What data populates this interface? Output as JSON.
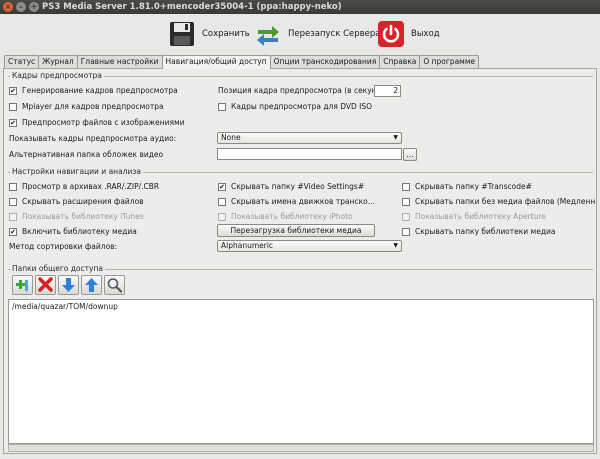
{
  "window": {
    "title": "PS3 Media Server 1.81.0+mencoder35004-1 (ppa:happy-neko)",
    "close_glyph": "×",
    "min_glyph": "–",
    "max_glyph": "+"
  },
  "toolbar": {
    "save_label": "Сохранить",
    "restart_label": "Перезапуск Сервера",
    "quit_label": "Выход"
  },
  "tabs": [
    {
      "label": "Статус"
    },
    {
      "label": "Журнал"
    },
    {
      "label": "Главные настройки"
    },
    {
      "label": "Навигация/общий доступ",
      "active": true
    },
    {
      "label": "Опции транскодирования"
    },
    {
      "label": "Справка"
    },
    {
      "label": "О программе"
    }
  ],
  "thumbnails": {
    "title": "Кадры предпросмотра",
    "gen_thumbs": {
      "label": "Генерирование кадров предпросмотра",
      "checked": true
    },
    "mplayer_thumbs": {
      "label": "Mplayer для кадров предпросмотра",
      "checked": false
    },
    "image_thumbs": {
      "label": "Предпросмотр файлов с изображениями",
      "checked": true
    },
    "thumb_position_label": "Позиция кадра предпросмотра (в секундах):",
    "thumb_position_value": "2",
    "dvd_iso_thumbs": {
      "label": "Кадры предпросмотра для DVD ISO",
      "checked": false
    },
    "audio_thumbs_label": "Показывать кадры предпросмотра аудио:",
    "audio_thumbs_value": "None",
    "alt_cover_label": "Альтернативная папка обложек видео",
    "alt_cover_value": "",
    "browse_label": "..."
  },
  "navigation": {
    "title": "Настройки навигации и анализа",
    "archives": {
      "label": "Просмотр в архивах .RAR/.ZIP/.CBR",
      "checked": false
    },
    "hide_video_settings": {
      "label": "Скрывать папку #Video Settings#",
      "checked": true
    },
    "hide_transcode": {
      "label": "Скрывать папку #Transcode#",
      "checked": false
    },
    "hide_extensions": {
      "label": "Скрывать расширения файлов",
      "checked": false
    },
    "hide_engines": {
      "label": "Скрывать имена движков транско...",
      "checked": false
    },
    "hide_empty_folders": {
      "label": "Скрывать папки без медиа файлов (Медленн",
      "checked": false
    },
    "show_itunes": {
      "label": "Показывать библиотеку iTunes",
      "checked": false,
      "disabled": true
    },
    "show_iphoto": {
      "label": "Показывать библиотеку iPhoto",
      "checked": false,
      "disabled": true
    },
    "show_aperture": {
      "label": "Показывать библиотеку Aperture",
      "checked": false,
      "disabled": true
    },
    "media_library": {
      "label": "Включить библиотеку медиа",
      "checked": true
    },
    "reload_library_label": "Перезагрузка библиотеки медиа",
    "hide_library_folder": {
      "label": "Скрывать папку библиотеки медиа",
      "checked": false
    },
    "sort_label": "Метод сортировки файлов:",
    "sort_value": "Alphanumeric"
  },
  "shared": {
    "title": "Папки общего доступа",
    "folders": [
      "/media/quazar/TOM/downup"
    ]
  },
  "colors": {
    "quit_red": "#d9232b",
    "restart_green": "#4a9a3a",
    "restart_blue": "#3d7fc1",
    "arrow_blue": "#2f7fd8",
    "remove_red": "#d81e1e",
    "add_green": "#3aa336"
  },
  "icons": [
    "floppy-disk-icon",
    "restart-arrows-icon",
    "power-icon",
    "add-folder-icon",
    "remove-icon",
    "arrow-down-icon",
    "arrow-up-icon",
    "magnifier-icon"
  ]
}
